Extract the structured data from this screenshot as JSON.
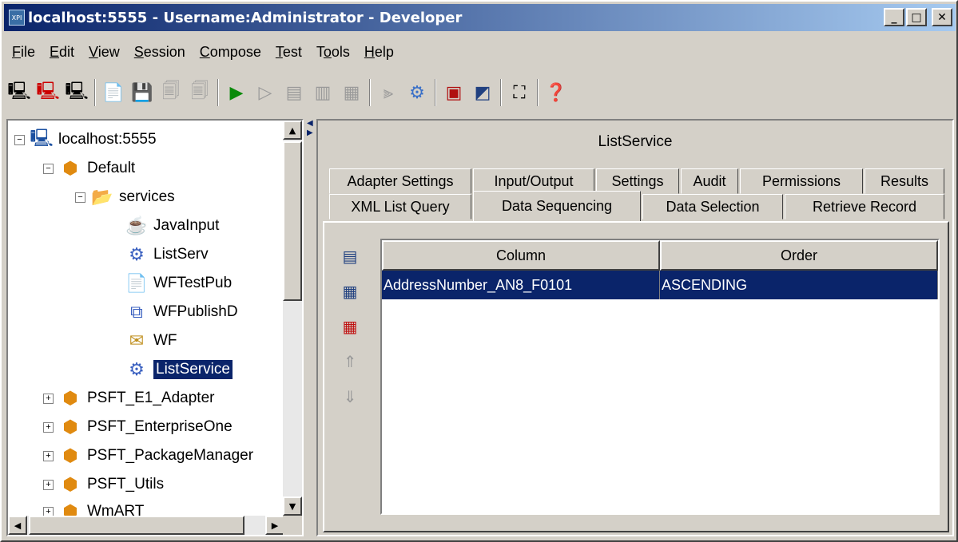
{
  "window": {
    "icon_text": "XPI",
    "title": "localhost:5555 - Username:Administrator - Developer",
    "min_btn": "_",
    "max_btn": "□",
    "close_btn": "✕"
  },
  "menu": [
    "File",
    "Edit",
    "View",
    "Session",
    "Compose",
    "Test",
    "Tools",
    "Help"
  ],
  "menu_mnemonics": [
    "F",
    "E",
    "V",
    "S",
    "C",
    "T",
    "o",
    "H"
  ],
  "tree": {
    "root": "localhost:5555",
    "default_pkg": "Default",
    "services_folder": "services",
    "items": [
      "JavaInput",
      "ListServ",
      "WFTestPub",
      "WFPublishD",
      "WF",
      "ListService"
    ],
    "packages": [
      "PSFT_E1_Adapter",
      "PSFT_EnterpriseOne",
      "PSFT_PackageManager",
      "PSFT_Utils",
      "WmART"
    ]
  },
  "service_title": "ListService",
  "tabs_row1": [
    "Adapter Settings",
    "Input/Output",
    "Settings",
    "Audit",
    "Permissions",
    "Results"
  ],
  "tabs_row2": [
    "XML List Query",
    "Data Sequencing",
    "Data Selection",
    "Retrieve Record"
  ],
  "active_tab": "Data Sequencing",
  "grid": {
    "columns": [
      "Column",
      "Order"
    ],
    "rows": [
      [
        "AddressNumber_AN8_F0101",
        "ASCENDING"
      ]
    ]
  }
}
